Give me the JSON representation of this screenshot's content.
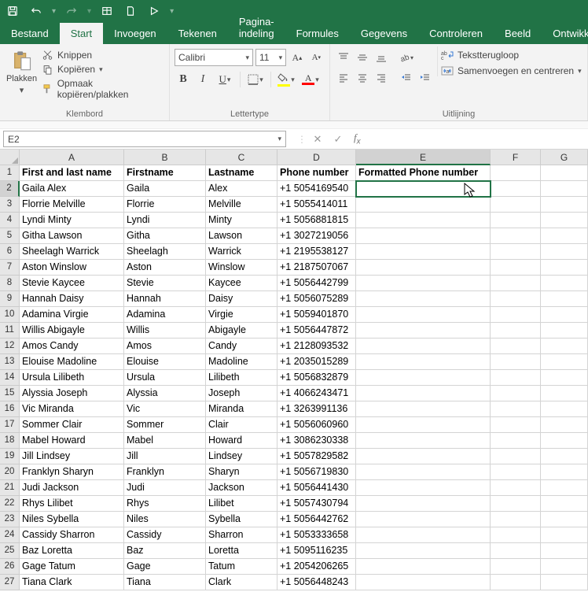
{
  "titlebar_icons": [
    "save",
    "undo",
    "redo",
    "table",
    "page",
    "play"
  ],
  "tabs": [
    "Bestand",
    "Start",
    "Invoegen",
    "Tekenen",
    "Pagina-indeling",
    "Formules",
    "Gegevens",
    "Controleren",
    "Beeld",
    "Ontwikkelaar"
  ],
  "active_tab": 1,
  "clipboard": {
    "paste": "Plakken",
    "cut": "Knippen",
    "copy": "Kopiëren",
    "fmt": "Opmaak kopiëren/plakken",
    "label": "Klembord"
  },
  "font": {
    "name": "Calibri",
    "size": "11",
    "label": "Lettertype"
  },
  "align": {
    "wrap": "Tekstterugloop",
    "merge": "Samenvoegen en centreren",
    "label": "Uitlijning"
  },
  "namebox": "E2",
  "colors": {
    "fill": "#ffff00",
    "font": "#ff0000",
    "accent": "#217346"
  },
  "columns": [
    "A",
    "B",
    "C",
    "D",
    "E",
    "F",
    "G"
  ],
  "headers": [
    "First and last name",
    "Firstname",
    "Lastname",
    "Phone number",
    "Formatted Phone number",
    "",
    ""
  ],
  "rows": [
    [
      "Gaila Alex",
      "Gaila",
      "Alex",
      "+1 5054169540",
      "",
      "",
      ""
    ],
    [
      "Florrie Melville",
      "Florrie",
      "Melville",
      "+1 5055414011",
      "",
      "",
      ""
    ],
    [
      "Lyndi Minty",
      "Lyndi",
      "Minty",
      "+1 5056881815",
      "",
      "",
      ""
    ],
    [
      "Githa Lawson",
      "Githa",
      "Lawson",
      "+1 3027219056",
      "",
      "",
      ""
    ],
    [
      "Sheelagh Warrick",
      "Sheelagh",
      "Warrick",
      "+1 2195538127",
      "",
      "",
      ""
    ],
    [
      "Aston Winslow",
      "Aston",
      "Winslow",
      "+1 2187507067",
      "",
      "",
      ""
    ],
    [
      "Stevie Kaycee",
      "Stevie",
      "Kaycee",
      "+1 5056442799",
      "",
      "",
      ""
    ],
    [
      "Hannah Daisy",
      "Hannah",
      "Daisy",
      "+1 5056075289",
      "",
      "",
      ""
    ],
    [
      "Adamina Virgie",
      "Adamina",
      "Virgie",
      "+1 5059401870",
      "",
      "",
      ""
    ],
    [
      "Willis Abigayle",
      "Willis",
      "Abigayle",
      "+1 5056447872",
      "",
      "",
      ""
    ],
    [
      "Amos Candy",
      "Amos",
      "Candy",
      "+1 2128093532",
      "",
      "",
      ""
    ],
    [
      "Elouise Madoline",
      "Elouise",
      "Madoline",
      "+1 2035015289",
      "",
      "",
      ""
    ],
    [
      "Ursula Lilibeth",
      "Ursula",
      "Lilibeth",
      "+1 5056832879",
      "",
      "",
      ""
    ],
    [
      "Alyssia Joseph",
      "Alyssia",
      "Joseph",
      "+1 4066243471",
      "",
      "",
      ""
    ],
    [
      "Vic Miranda",
      "Vic",
      "Miranda",
      "+1 3263991136",
      "",
      "",
      ""
    ],
    [
      "Sommer Clair",
      "Sommer",
      "Clair",
      "+1 5056060960",
      "",
      "",
      ""
    ],
    [
      "Mabel Howard",
      "Mabel",
      "Howard",
      "+1 3086230338",
      "",
      "",
      ""
    ],
    [
      "Jill Lindsey",
      "Jill",
      "Lindsey",
      "+1 5057829582",
      "",
      "",
      ""
    ],
    [
      "Franklyn Sharyn",
      "Franklyn",
      "Sharyn",
      "+1 5056719830",
      "",
      "",
      ""
    ],
    [
      "Judi Jackson",
      "Judi",
      "Jackson",
      "+1 5056441430",
      "",
      "",
      ""
    ],
    [
      "Rhys Lilibet",
      "Rhys",
      "Lilibet",
      "+1 5057430794",
      "",
      "",
      ""
    ],
    [
      "Niles Sybella",
      "Niles",
      "Sybella",
      "+1 5056442762",
      "",
      "",
      ""
    ],
    [
      "Cassidy Sharron",
      "Cassidy",
      "Sharron",
      "+1 5053333658",
      "",
      "",
      ""
    ],
    [
      "Baz Loretta",
      "Baz",
      "Loretta",
      "+1 5095116235",
      "",
      "",
      ""
    ],
    [
      "Gage Tatum",
      "Gage",
      "Tatum",
      "+1 2054206265",
      "",
      "",
      ""
    ],
    [
      "Tiana Clark",
      "Tiana",
      "Clark",
      "+1 5056448243",
      "",
      "",
      ""
    ]
  ]
}
